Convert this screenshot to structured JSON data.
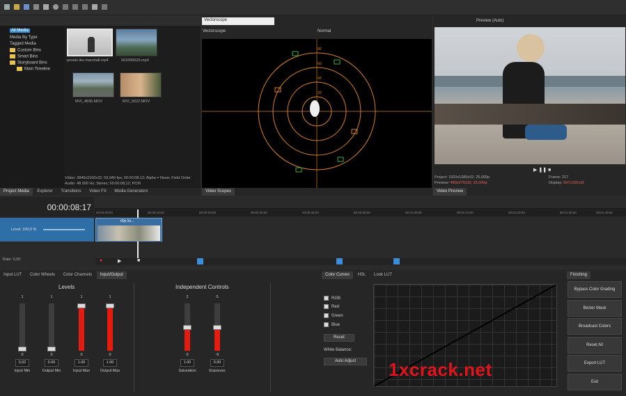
{
  "toolbar": {
    "icons": [
      "new-icon",
      "open-icon",
      "save-icon",
      "save-as-icon",
      "render-icon",
      "settings-icon",
      "cut-icon",
      "copy-icon",
      "paste-icon",
      "undo-icon",
      "redo-icon"
    ]
  },
  "explorer": {
    "tree": [
      {
        "label": "All Media",
        "selected": true
      },
      {
        "label": "Media By Type"
      },
      {
        "label": "Tagged Media"
      },
      {
        "label": "Custom Bins"
      },
      {
        "label": "Smart Bins"
      },
      {
        "label": "Storyboard Bins"
      },
      {
        "label": "Main Timeline"
      }
    ],
    "files": [
      {
        "name": "pexels-ike-marshall.mp4"
      },
      {
        "name": "563399626.mp4"
      },
      {
        "name": "MVI_4835.MOV"
      },
      {
        "name": "MVI_5022.MOV"
      }
    ],
    "info_line1": "Video: 3840x2160x32; 59,940 fps; 00:00:08;12; Alpha = None; Field Order",
    "info_line2": "Audio: 48.000 Hz; Stereo; 00:00:08;12; PCM",
    "tabs": [
      "Project Media",
      "Explorer",
      "Transitions",
      "Video FX",
      "Media Generators"
    ]
  },
  "scopes": {
    "dropdown_value": "Vectorscope",
    "title": "Vectorscope",
    "mode": "Normal",
    "ring_labels": [
      "80",
      "60",
      "40",
      "20"
    ],
    "tab": "Video Scopes"
  },
  "preview": {
    "title": "Preview (Auto)",
    "project_label": "Project:",
    "project_value": "1920x1080x32; 25,000p",
    "preview_label": "Preview:",
    "preview_value": "480x270x32; 25,000p",
    "frame_label": "Frame:",
    "frame_value": "217",
    "display_label": "Display:",
    "display_value": "597x336x32",
    "tab": "Video Preview"
  },
  "timeline": {
    "timecode": "00:00:08:17",
    "track_level": "Level: 100,0 %",
    "clip_label": "60p 5n...",
    "rate": "Rate: 0,00",
    "ruler": [
      "00:00:00;00",
      "00:00:10;00",
      "00:00:20;00",
      "00:00:30;00",
      "00:00:40;00",
      "00:00:50;00",
      "00:01:00;00",
      "00:01:10;00",
      "00:01:20;00",
      "00:01:30;00",
      "00:01:40;00"
    ]
  },
  "colorgrading": {
    "tabs": [
      "Input LUT",
      "Color Wheels",
      "Color Channels",
      "Input/Output"
    ],
    "levels_title": "Levels",
    "independent_title": "Independent Controls",
    "levels": [
      {
        "label": "Input Min",
        "top": "1",
        "bottom": "0",
        "value": "0,02",
        "level": 0.0
      },
      {
        "label": "Output Min",
        "top": "1",
        "bottom": "0",
        "value": "0.00",
        "level": 0.0
      },
      {
        "label": "Input Max",
        "top": "1",
        "bottom": "0",
        "value": "1.00",
        "level": 1.0
      },
      {
        "label": "Output Max",
        "top": "1",
        "bottom": "0",
        "value": "1.00",
        "level": 1.0
      }
    ],
    "independent": [
      {
        "label": "Saturation",
        "top": "2",
        "bottom": "0",
        "value": "1.00",
        "level": 0.5
      },
      {
        "label": "Exposure",
        "top": "5",
        "bottom": "-5",
        "value": "0.00",
        "level": 0.5
      }
    ],
    "curve_tabs": [
      "Color Curves",
      "HSL",
      "Look LUT"
    ],
    "channels": [
      "RGB",
      "Red",
      "Green",
      "Blue"
    ],
    "reset_label": "Reset",
    "white_balance_label": "White Balance:",
    "auto_adjust_label": "Auto Adjust",
    "watermark": "1xcrack.net"
  },
  "finishing": {
    "tab": "Finishing",
    "buttons": [
      "Bypass Color Grading",
      "Bézier Mask",
      "Broadcast Colors",
      "Reset All",
      "Export LUT",
      "Exit"
    ]
  },
  "colors": {
    "accent": "#3b8fd8",
    "slider_red": "#e41b0f",
    "scope_orange": "#d9822b",
    "scope_green": "#3fae3f",
    "clip_blue": "#2f6fa8"
  }
}
